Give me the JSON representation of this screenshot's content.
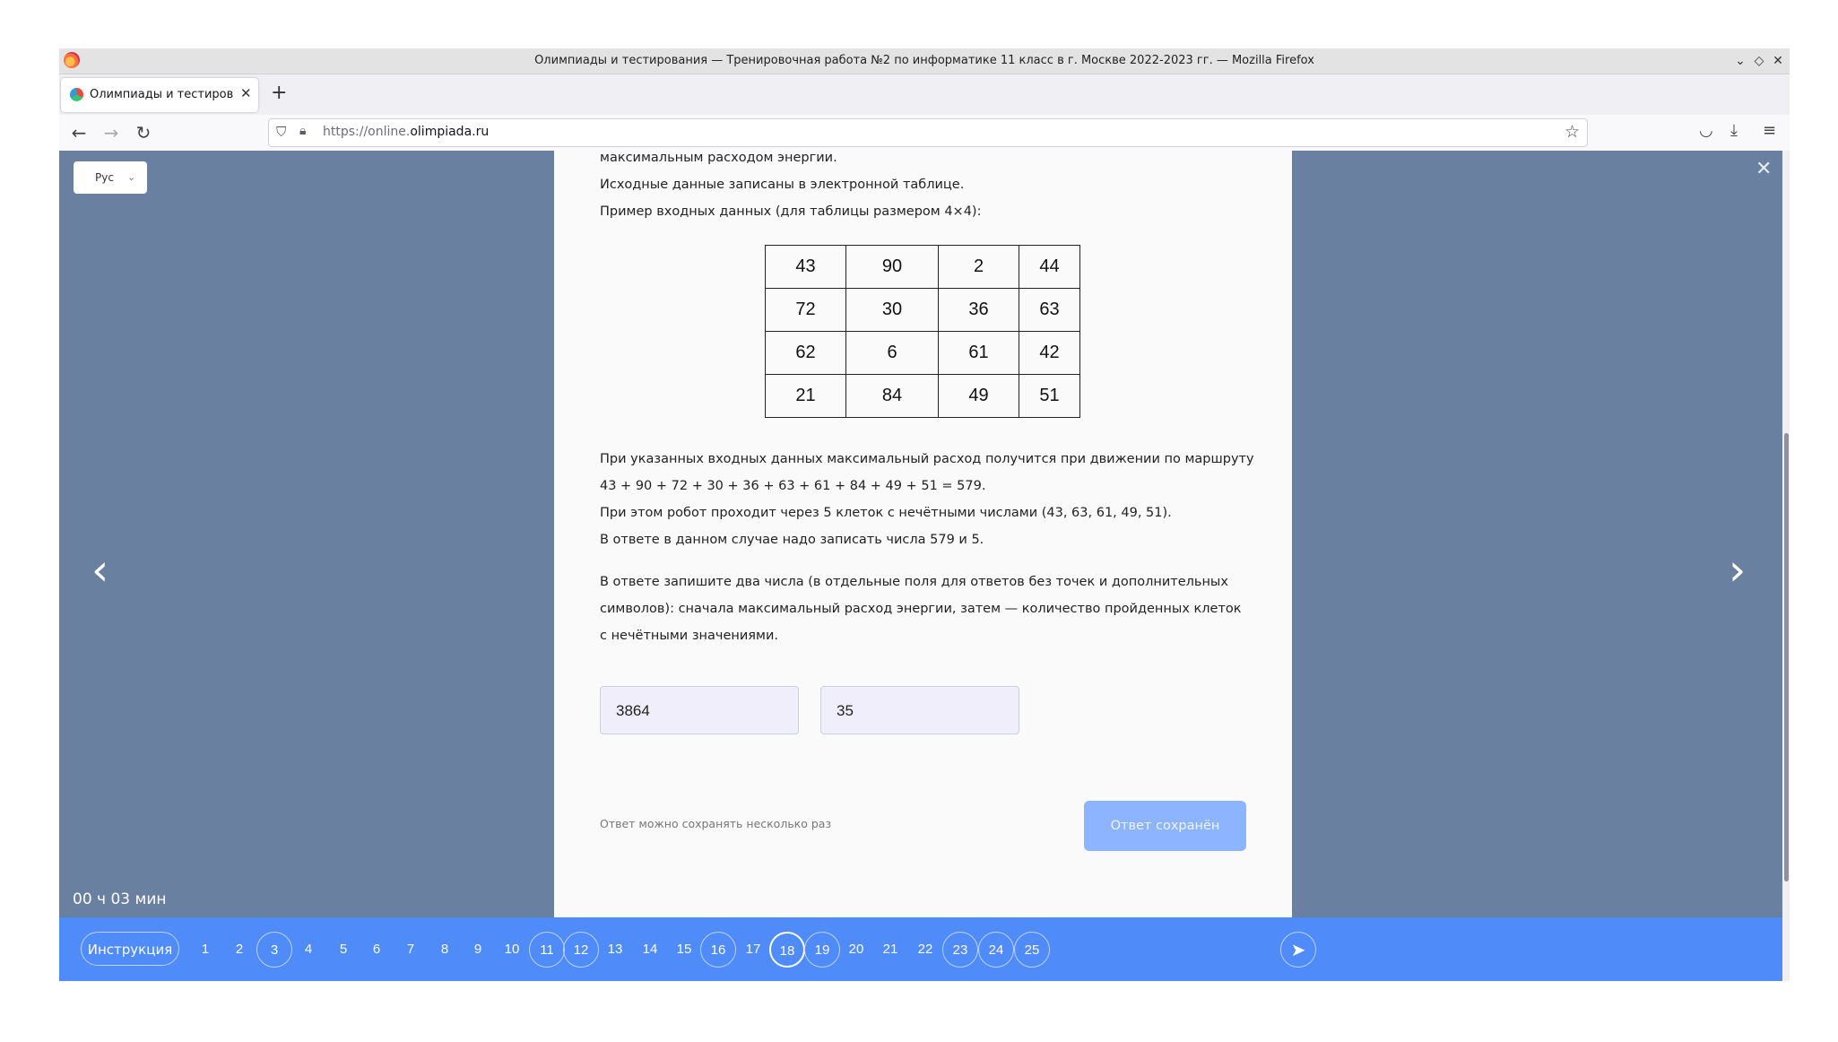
{
  "browser": {
    "window_title": "Олимпиады и тестирования — Тренировочная работа №2 по информатике 11 класс в г. Москве 2022-2023 гг. — Mozilla Firefox",
    "tab_title": "Олимпиады и тестирования",
    "url_prefix": "https://online.",
    "url_domain": "olimpiada.ru"
  },
  "page": {
    "language": "Рус",
    "paragraphs": {
      "p1": "максимальным расходом энергии.",
      "p2": "Исходные данные записаны в электронной таблице.",
      "p3": "Пример входных данных (для таблицы размером 4×4):",
      "p4": "При указанных входных данных максимальный расход получится при движении по маршруту",
      "p5": "43 + 90 + 72 + 30 + 36 + 63 + 61 + 84 + 49 + 51 = 579.",
      "p6": "При этом робот проходит через 5 клеток с нечётными числами (43, 63, 61, 49, 51).",
      "p7": "В ответе в данном случае надо записать числа 579 и 5.",
      "p8": "В ответе запишите два числа (в отдельные поля для ответов без точек и дополнительных",
      "p9": "символов): сначала максимальный расход энергии, затем — количество пройденных клеток",
      "p10": "с нечётными значениями."
    },
    "table": [
      [
        "43",
        "90",
        "2",
        "44"
      ],
      [
        "72",
        "30",
        "36",
        "63"
      ],
      [
        "62",
        "6",
        "61",
        "42"
      ],
      [
        "21",
        "84",
        "49",
        "51"
      ]
    ],
    "answers": [
      "3864",
      "35"
    ],
    "save_note": "Ответ можно сохранять несколько раз",
    "save_button": "Ответ сохранён",
    "timer": "00 ч 03 мин"
  },
  "navigation": {
    "instruction_label": "Инструкция",
    "questions": [
      {
        "n": "1",
        "state": "plain"
      },
      {
        "n": "2",
        "state": "plain"
      },
      {
        "n": "3",
        "state": "answered"
      },
      {
        "n": "4",
        "state": "plain"
      },
      {
        "n": "5",
        "state": "plain"
      },
      {
        "n": "6",
        "state": "plain"
      },
      {
        "n": "7",
        "state": "plain"
      },
      {
        "n": "8",
        "state": "plain"
      },
      {
        "n": "9",
        "state": "plain"
      },
      {
        "n": "10",
        "state": "plain"
      },
      {
        "n": "11",
        "state": "answered"
      },
      {
        "n": "12",
        "state": "answered"
      },
      {
        "n": "13",
        "state": "plain"
      },
      {
        "n": "14",
        "state": "plain"
      },
      {
        "n": "15",
        "state": "plain"
      },
      {
        "n": "16",
        "state": "answered"
      },
      {
        "n": "17",
        "state": "plain"
      },
      {
        "n": "18",
        "state": "current"
      },
      {
        "n": "19",
        "state": "answered"
      },
      {
        "n": "20",
        "state": "plain"
      },
      {
        "n": "21",
        "state": "plain"
      },
      {
        "n": "22",
        "state": "plain"
      },
      {
        "n": "23",
        "state": "answered"
      },
      {
        "n": "24",
        "state": "answered"
      },
      {
        "n": "25",
        "state": "answered"
      }
    ]
  },
  "colors": {
    "page_background": "#6980a0",
    "bottom_bar": "#4f8bf9",
    "save_button": "#8cb4ff"
  }
}
